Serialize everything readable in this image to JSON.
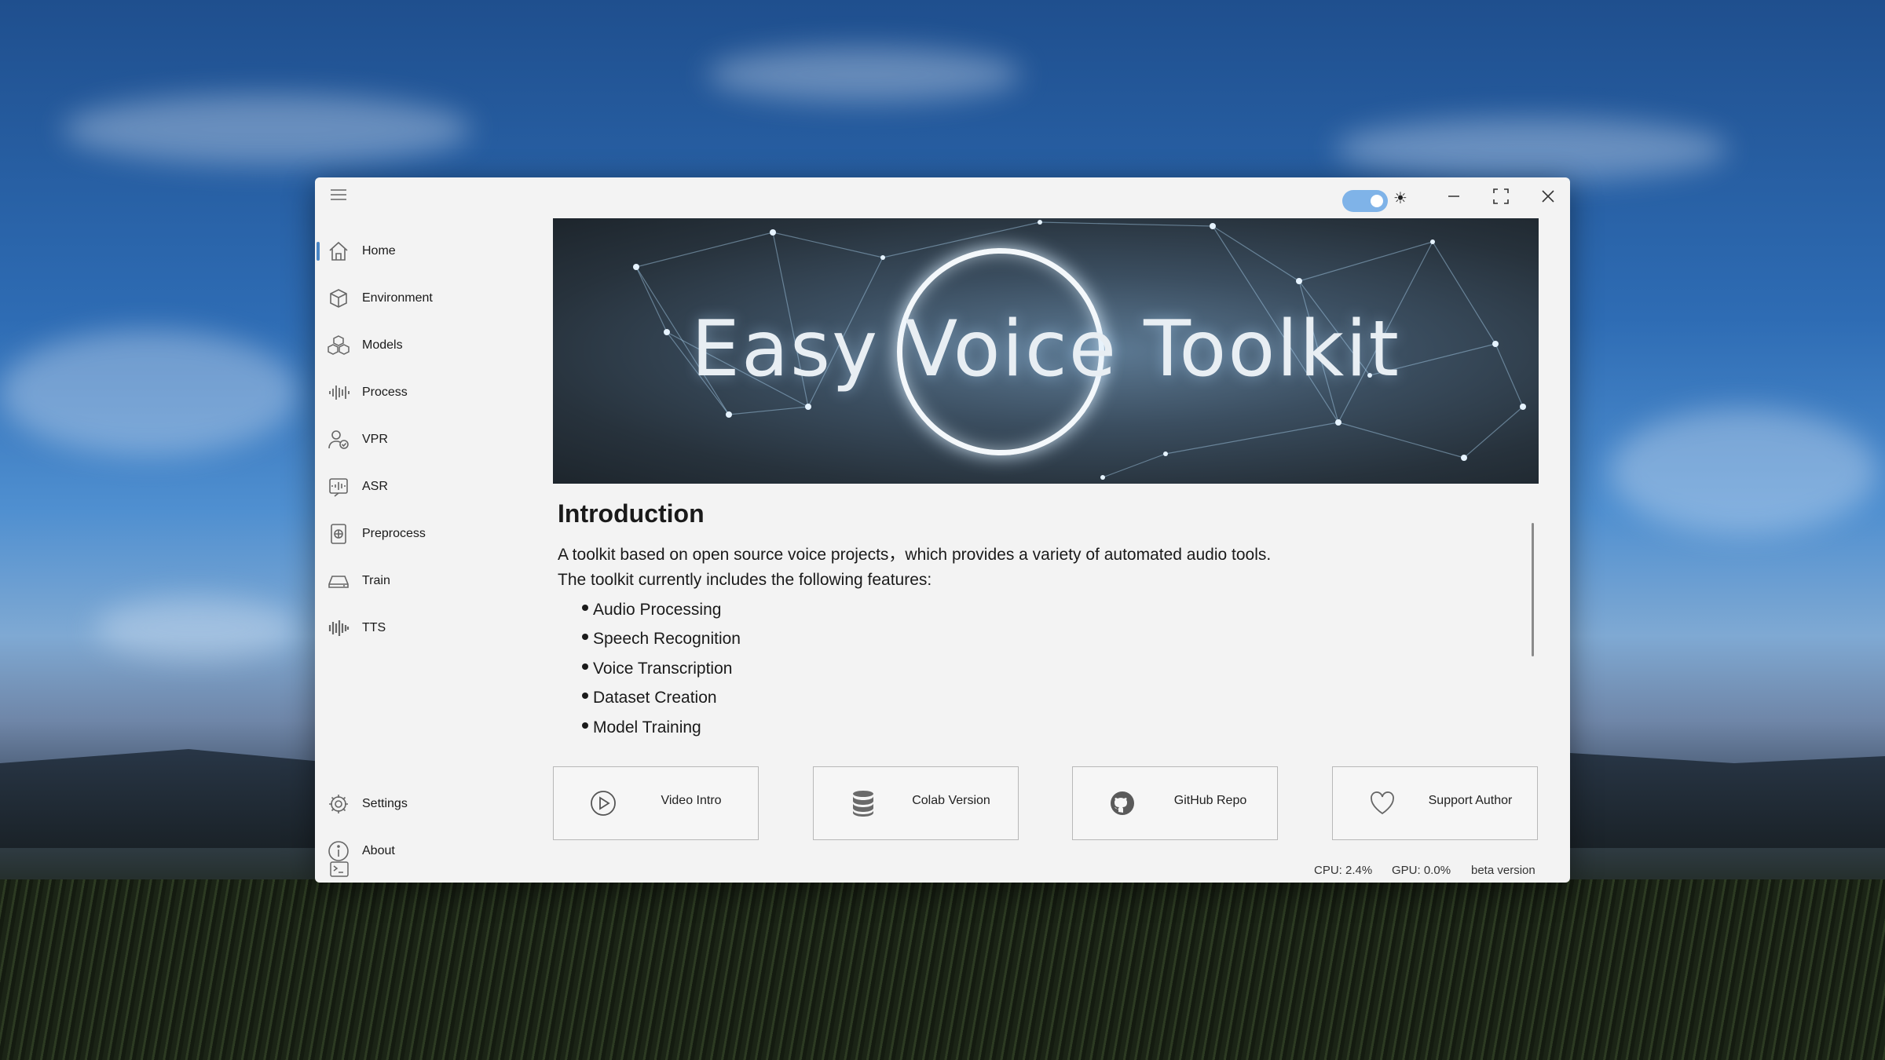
{
  "app": {
    "banner_title": "Easy Voice Toolkit"
  },
  "sidebar": {
    "items": [
      {
        "label": "Home",
        "icon": "home-icon"
      },
      {
        "label": "Environment",
        "icon": "box-icon"
      },
      {
        "label": "Models",
        "icon": "cubes-icon"
      },
      {
        "label": "Process",
        "icon": "waveform-icon"
      },
      {
        "label": "VPR",
        "icon": "user-check-icon"
      },
      {
        "label": "ASR",
        "icon": "speech-icon"
      },
      {
        "label": "Preprocess",
        "icon": "document-icon"
      },
      {
        "label": "Train",
        "icon": "drive-icon"
      },
      {
        "label": "TTS",
        "icon": "audio-bars-icon"
      }
    ],
    "bottom_items": [
      {
        "label": "Settings",
        "icon": "gear-icon"
      },
      {
        "label": "About",
        "icon": "info-icon"
      }
    ]
  },
  "intro": {
    "title": "Introduction",
    "line1": "A toolkit based on open source voice projects，which provides a variety of automated audio tools.",
    "line2": "The toolkit currently includes the following features:",
    "features": [
      "Audio Processing",
      "Speech Recognition",
      "Voice Transcription",
      "Dataset Creation",
      "Model Training"
    ]
  },
  "cards": [
    {
      "label": "Video Intro",
      "icon": "play-icon"
    },
    {
      "label": "Colab Version",
      "icon": "database-icon"
    },
    {
      "label": "GitHub Repo",
      "icon": "github-icon"
    },
    {
      "label": "Support Author",
      "icon": "heart-icon"
    }
  ],
  "status": {
    "cpu": "CPU: 2.4%",
    "gpu": "GPU: 0.0%",
    "version": "beta version"
  },
  "theme_toggle": {
    "state": "on"
  },
  "colors": {
    "accent": "#4a86c5",
    "toggle": "#7fb3e8",
    "window_bg": "#f3f3f3"
  }
}
